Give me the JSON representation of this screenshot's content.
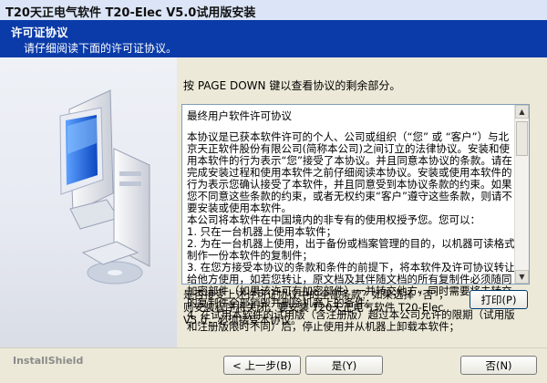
{
  "window": {
    "title": "T20天正电气软件 T20-Elec V5.0试用版安装"
  },
  "header": {
    "title": "许可证协议",
    "subtitle": "请仔细阅读下面的许可证协议。"
  },
  "main": {
    "intro": "按 PAGE DOWN 键以查看协议的剩余部分。",
    "license_title": "最终用户软件许可协议",
    "license_paragraphs": [
      "本协议是已获本软件许可的个人、公司或组织（“您” 或 “客户”）与北京天正软件股份有限公司(简称本公司)之间订立的法律协议。安装和使用本软件的行为表示“您”接受了本协议。并且同意本协议的条款。请在完成安装过程和使用本软件之前仔细阅读本协议。安装或使用本软件的行为表示您确认接受了本软件，并且同意受到本协议条款的约束。如果您不同意这些条款的约束，或者无权约束“客户”遵守这些条款，则请不要安装或使用本软件。",
      "本公司将本软件在中国境内的非专有的使用权授予您。您可以：",
      "1. 只在一台机器上使用本软件；",
      "2. 为在一台机器上使用，出于备份或档案管理的目的，以机器可读格式制作一份本软件的复制件；",
      "3. 在您方接受本协议的条款和条件的前提下，将本软件及许可协议转让给他方使用，如若您转让，原文档及其伴随文档的所有复制件必须随同加密部件（如果该许可有加密部件）一并转交他方，同时需要将未转交的复制件全部销毁并删除机器上的备件；",
      "4. 在试用本软件的试用版（含注册版）超过本公司允许的限期（试用版和注册版限时不同）后，停止使用并从机器上卸载本软件；"
    ],
    "question": "是否接受上述许可证协议中的全部条款？如果选择 “否”，则安装程序将关闭。要安装 T20天正电气软件 T20-Elec V5.0，必须接受本协议。",
    "print_label": "打印(P)"
  },
  "footer": {
    "brand": "InstallShield",
    "back_label": "< 上一步(B)",
    "yes_label": "是(Y)",
    "no_label": "否(N)"
  }
}
